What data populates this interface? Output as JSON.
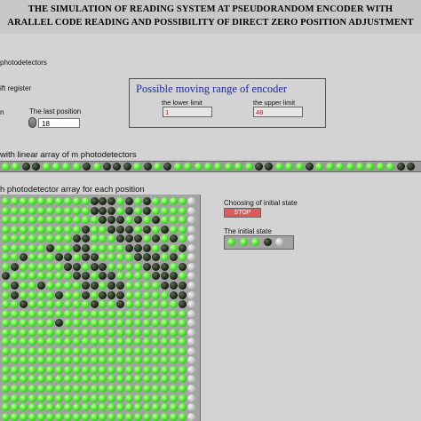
{
  "title": {
    "line1": "THE SIMULATION OF READING SYSTEM AT PSEUDORANDOM ENCODER WITH",
    "line2": "ARALLEL CODE READING AND POSSIBILITY OF DIRECT ZERO POSITION ADJUSTMENT"
  },
  "labels": {
    "photodetectors": "photodetectors",
    "shift_register": "ift register",
    "n_label": "n",
    "last_position": "The last position"
  },
  "last_position_value": "18",
  "range": {
    "title": "Possible moving range of encoder",
    "lower_label": "the lower limit",
    "lower_value": "1",
    "upper_label": "the upper limit",
    "upper_value": "48"
  },
  "linear_array_label": "with linear array of m photodetectors",
  "matrix_label": "h photodetector array for each position",
  "initial_state": {
    "choosing_label": "Choosing of initial state",
    "button_label": "STOP",
    "state_label": "The initial state",
    "leds": [
      "on",
      "on",
      "on",
      "off",
      "gray"
    ]
  },
  "linear_leds": [
    "on",
    "on",
    "off",
    "off",
    "on",
    "on",
    "on",
    "on",
    "off",
    "on",
    "off",
    "off",
    "off",
    "on",
    "off",
    "on",
    "off",
    "on",
    "on",
    "on",
    "on",
    "on",
    "on",
    "on",
    "on",
    "off",
    "off",
    "on",
    "on",
    "on",
    "off",
    "on",
    "on",
    "on",
    "on",
    "on",
    "on",
    "on",
    "on",
    "off",
    "off"
  ],
  "matrix_leds": [
    [
      "on",
      "on",
      "on",
      "on",
      "on",
      "on",
      "on",
      "on",
      "on",
      "on",
      "off",
      "off",
      "off",
      "on",
      "off",
      "on",
      "off",
      "on",
      "on",
      "on",
      "on",
      "gray"
    ],
    [
      "on",
      "on",
      "on",
      "on",
      "on",
      "on",
      "on",
      "on",
      "on",
      "on",
      "off",
      "off",
      "off",
      "on",
      "off",
      "on",
      "off",
      "on",
      "on",
      "on",
      "on",
      "gray"
    ],
    [
      "on",
      "on",
      "on",
      "on",
      "on",
      "on",
      "on",
      "on",
      "on",
      "on",
      "on",
      "off",
      "off",
      "off",
      "on",
      "off",
      "on",
      "off",
      "on",
      "on",
      "on",
      "gray"
    ],
    [
      "on",
      "on",
      "on",
      "on",
      "on",
      "on",
      "on",
      "on",
      "on",
      "off",
      "on",
      "on",
      "off",
      "off",
      "off",
      "on",
      "off",
      "on",
      "off",
      "on",
      "on",
      "gray"
    ],
    [
      "on",
      "on",
      "on",
      "on",
      "on",
      "on",
      "on",
      "on",
      "off",
      "off",
      "on",
      "on",
      "on",
      "off",
      "off",
      "off",
      "on",
      "off",
      "on",
      "off",
      "on",
      "gray"
    ],
    [
      "on",
      "on",
      "on",
      "on",
      "on",
      "off",
      "on",
      "on",
      "off",
      "off",
      "on",
      "on",
      "on",
      "on",
      "off",
      "off",
      "off",
      "on",
      "off",
      "on",
      "off",
      "gray"
    ],
    [
      "on",
      "on",
      "off",
      "on",
      "on",
      "on",
      "off",
      "off",
      "on",
      "off",
      "off",
      "on",
      "on",
      "on",
      "on",
      "off",
      "off",
      "off",
      "on",
      "off",
      "on",
      "gray"
    ],
    [
      "on",
      "off",
      "on",
      "on",
      "on",
      "on",
      "on",
      "off",
      "off",
      "on",
      "off",
      "off",
      "on",
      "on",
      "on",
      "on",
      "off",
      "off",
      "off",
      "on",
      "off",
      "gray"
    ],
    [
      "off",
      "on",
      "on",
      "on",
      "on",
      "on",
      "on",
      "on",
      "off",
      "off",
      "on",
      "off",
      "off",
      "on",
      "on",
      "on",
      "on",
      "off",
      "off",
      "off",
      "on",
      "gray"
    ],
    [
      "on",
      "off",
      "on",
      "on",
      "off",
      "on",
      "on",
      "on",
      "on",
      "off",
      "off",
      "on",
      "off",
      "off",
      "on",
      "on",
      "on",
      "on",
      "off",
      "off",
      "off",
      "gray"
    ],
    [
      "on",
      "off",
      "on",
      "on",
      "on",
      "on",
      "off",
      "on",
      "on",
      "off",
      "on",
      "off",
      "off",
      "off",
      "on",
      "on",
      "on",
      "on",
      "on",
      "off",
      "off",
      "gray"
    ],
    [
      "on",
      "on",
      "off",
      "on",
      "on",
      "on",
      "on",
      "on",
      "on",
      "on",
      "off",
      "on",
      "on",
      "off",
      "on",
      "on",
      "on",
      "on",
      "on",
      "on",
      "off",
      "gray"
    ],
    [
      "on",
      "on",
      "on",
      "on",
      "on",
      "on",
      "on",
      "on",
      "on",
      "on",
      "on",
      "on",
      "on",
      "on",
      "on",
      "on",
      "on",
      "on",
      "on",
      "on",
      "on",
      "gray"
    ],
    [
      "on",
      "on",
      "on",
      "on",
      "on",
      "on",
      "off",
      "on",
      "on",
      "on",
      "on",
      "on",
      "on",
      "on",
      "on",
      "on",
      "on",
      "on",
      "on",
      "on",
      "on",
      "gray"
    ],
    [
      "on",
      "on",
      "on",
      "on",
      "on",
      "on",
      "on",
      "on",
      "on",
      "on",
      "on",
      "on",
      "on",
      "on",
      "on",
      "on",
      "on",
      "on",
      "on",
      "on",
      "on",
      "gray"
    ],
    [
      "on",
      "on",
      "on",
      "on",
      "on",
      "on",
      "on",
      "on",
      "on",
      "on",
      "on",
      "on",
      "on",
      "on",
      "on",
      "on",
      "on",
      "on",
      "on",
      "on",
      "on",
      "gray"
    ],
    [
      "on",
      "on",
      "on",
      "on",
      "on",
      "on",
      "on",
      "on",
      "on",
      "on",
      "on",
      "on",
      "on",
      "on",
      "on",
      "on",
      "on",
      "on",
      "on",
      "on",
      "on",
      "gray"
    ],
    [
      "on",
      "on",
      "on",
      "on",
      "on",
      "on",
      "on",
      "on",
      "on",
      "on",
      "on",
      "on",
      "on",
      "on",
      "on",
      "on",
      "on",
      "on",
      "on",
      "on",
      "on",
      "gray"
    ],
    [
      "on",
      "on",
      "on",
      "on",
      "on",
      "on",
      "on",
      "on",
      "on",
      "on",
      "on",
      "on",
      "on",
      "on",
      "on",
      "on",
      "on",
      "on",
      "on",
      "on",
      "on",
      "gray"
    ],
    [
      "on",
      "on",
      "on",
      "on",
      "on",
      "on",
      "on",
      "on",
      "on",
      "on",
      "on",
      "on",
      "on",
      "on",
      "on",
      "on",
      "on",
      "on",
      "on",
      "on",
      "on",
      "gray"
    ],
    [
      "on",
      "on",
      "on",
      "on",
      "on",
      "on",
      "on",
      "on",
      "on",
      "on",
      "on",
      "on",
      "on",
      "on",
      "on",
      "on",
      "on",
      "on",
      "on",
      "on",
      "on",
      "gray"
    ],
    [
      "on",
      "on",
      "on",
      "on",
      "on",
      "on",
      "on",
      "on",
      "on",
      "on",
      "on",
      "on",
      "on",
      "on",
      "on",
      "on",
      "on",
      "on",
      "on",
      "on",
      "on",
      "gray"
    ],
    [
      "on",
      "on",
      "on",
      "on",
      "on",
      "on",
      "on",
      "on",
      "on",
      "on",
      "on",
      "on",
      "on",
      "on",
      "on",
      "on",
      "on",
      "on",
      "on",
      "on",
      "on",
      "gray"
    ],
    [
      "on",
      "on",
      "on",
      "on",
      "on",
      "on",
      "on",
      "on",
      "on",
      "on",
      "on",
      "on",
      "on",
      "on",
      "on",
      "on",
      "on",
      "on",
      "on",
      "on",
      "on",
      "gray"
    ]
  ]
}
